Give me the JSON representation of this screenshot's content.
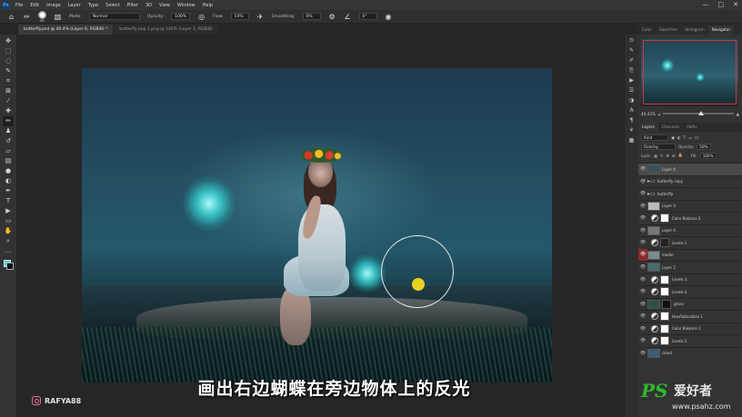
{
  "menubar": {
    "app_icon": "Ps",
    "items": [
      "File",
      "Edit",
      "Image",
      "Layer",
      "Type",
      "Select",
      "Filter",
      "3D",
      "View",
      "Window",
      "Help"
    ],
    "window_controls": [
      "—",
      "□",
      "✕"
    ]
  },
  "options_bar": {
    "mode_label": "Mode:",
    "mode_value": "Normal",
    "opacity_label": "Opacity:",
    "opacity_value": "100%",
    "flow_label": "Flow:",
    "flow_value": "54%",
    "smoothing_label": "Smoothing:",
    "smoothing_value": "0%",
    "angle_value": "0°",
    "brush_size": "60"
  },
  "tabs": [
    {
      "label": "butterfly.psd @ 40.4% (Layer 6, RGB/8) *",
      "active": true
    },
    {
      "label": "butterfly pop 1.png @ 142% (Layer 1, RGB/8)",
      "active": false
    }
  ],
  "tools": [
    {
      "icon": "move-icon",
      "glyph": "✥"
    },
    {
      "icon": "marquee-icon",
      "glyph": "⬚"
    },
    {
      "icon": "lasso-icon",
      "glyph": "◌"
    },
    {
      "icon": "quick-select-icon",
      "glyph": "✎"
    },
    {
      "icon": "crop-icon",
      "glyph": "⌗"
    },
    {
      "icon": "frame-icon",
      "glyph": "⊠"
    },
    {
      "icon": "eyedropper-icon",
      "glyph": "⁄"
    },
    {
      "icon": "healing-icon",
      "glyph": "✚"
    },
    {
      "icon": "brush-icon",
      "glyph": "✏"
    },
    {
      "icon": "stamp-icon",
      "glyph": "♟"
    },
    {
      "icon": "history-brush-icon",
      "glyph": "↺"
    },
    {
      "icon": "eraser-icon",
      "glyph": "▱"
    },
    {
      "icon": "gradient-icon",
      "glyph": "▤"
    },
    {
      "icon": "blur-icon",
      "glyph": "●"
    },
    {
      "icon": "dodge-icon",
      "glyph": "◐"
    },
    {
      "icon": "pen-icon",
      "glyph": "✒"
    },
    {
      "icon": "type-icon",
      "glyph": "T"
    },
    {
      "icon": "path-select-icon",
      "glyph": "▶"
    },
    {
      "icon": "shape-icon",
      "glyph": "▭"
    },
    {
      "icon": "hand-icon",
      "glyph": "✋"
    },
    {
      "icon": "zoom-icon",
      "glyph": "⌕"
    },
    {
      "icon": "more-icon",
      "glyph": "…"
    }
  ],
  "canvas": {
    "subtitle": "画出右边蝴蝶在旁边物体上的反光",
    "watermark_handle": "RAFYA88",
    "accent_cursor": "#e8d020",
    "glow_color": "#44e0e0"
  },
  "right_panel": {
    "top_tabs": [
      "Color",
      "Swatches",
      "Histogram",
      "Navigator"
    ],
    "active_top_tab": "Navigator",
    "zoom_value": "40.42%",
    "layer_tabs": [
      "Layers",
      "Channels",
      "Paths"
    ],
    "kind_label": "Kind",
    "blend_mode": "Overlay",
    "opacity_label": "Opacity:",
    "opacity_value": "50%",
    "lock_label": "Lock:",
    "fill_label": "Fill:",
    "fill_value": "100%",
    "layers": [
      {
        "name": "Layer 6",
        "type": "pixel",
        "selected": true,
        "thumb": "#3a5058"
      },
      {
        "name": "butterfly copy",
        "type": "group",
        "selected": false
      },
      {
        "name": "butterfly",
        "type": "group",
        "selected": false
      },
      {
        "name": "Layer 3",
        "type": "pixel",
        "selected": false,
        "thumb": "#bbbbbb"
      },
      {
        "name": "Color Balance 2",
        "type": "adjustment",
        "selected": false
      },
      {
        "name": "Layer 4",
        "type": "pixel",
        "selected": false,
        "thumb": "#777777"
      },
      {
        "name": "Levels 1",
        "type": "adjustment",
        "selected": false,
        "mask": "#222222"
      },
      {
        "name": "model",
        "type": "pixel",
        "selected": false,
        "thumb": "#7a8a90",
        "eye_red": true
      },
      {
        "name": "Layer 2",
        "type": "pixel",
        "selected": false,
        "thumb": "#4a6a70"
      },
      {
        "name": "Levels 3",
        "type": "adjustment",
        "selected": false
      },
      {
        "name": "Levels 4",
        "type": "adjustment",
        "selected": false
      },
      {
        "name": "grass",
        "type": "pixel",
        "selected": false,
        "thumb": "#2e5048",
        "mask": "#111111"
      },
      {
        "name": "Hue/Saturation 1",
        "type": "adjustment",
        "selected": false
      },
      {
        "name": "Color Balance 1",
        "type": "adjustment",
        "selected": false
      },
      {
        "name": "Levels 2",
        "type": "adjustment",
        "selected": false
      },
      {
        "name": "cloud",
        "type": "pixel",
        "selected": false,
        "thumb": "#3c5c74"
      }
    ]
  },
  "site_watermark": {
    "ps": "PS",
    "cn": "爱好者",
    "url": "www.psahz.com"
  }
}
